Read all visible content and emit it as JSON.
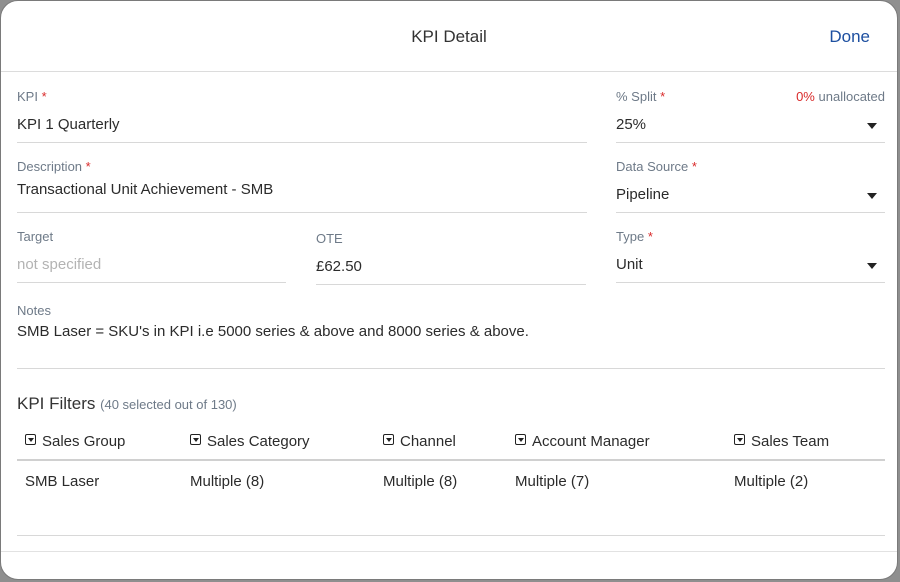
{
  "header": {
    "title": "KPI Detail",
    "done_label": "Done"
  },
  "form": {
    "kpi": {
      "label": "KPI",
      "value": "KPI 1 Quarterly"
    },
    "split": {
      "label": "% Split",
      "value": "25%",
      "unallocated_pct": "0%",
      "unallocated_text": "unallocated"
    },
    "description": {
      "label": "Description",
      "value": "Transactional Unit Achievement - SMB"
    },
    "data_source": {
      "label": "Data Source",
      "value": "Pipeline"
    },
    "target": {
      "label": "Target",
      "placeholder": "not specified"
    },
    "ote": {
      "label": "OTE",
      "value": "£62.50"
    },
    "type": {
      "label": "Type",
      "value": "Unit"
    },
    "notes": {
      "label": "Notes",
      "value": "SMB Laser = SKU's in KPI i.e 5000 series & above and 8000 series & above."
    },
    "required_marker": "*"
  },
  "filters": {
    "title": "KPI Filters",
    "count_text": "(40 selected out of 130)",
    "columns": [
      "Sales Group",
      "Sales Category",
      "Channel",
      "Account Manager",
      "Sales Team"
    ],
    "row": [
      "SMB Laser",
      "Multiple (8)",
      "Multiple (8)",
      "Multiple (7)",
      "Multiple (2)"
    ]
  },
  "colors": {
    "accent": "#1d4fa0",
    "required": "#d92a2a",
    "label": "#6e7a88"
  },
  "icons": {
    "dropdown": "caret-down-icon",
    "filter": "filter-dropdown-icon"
  }
}
